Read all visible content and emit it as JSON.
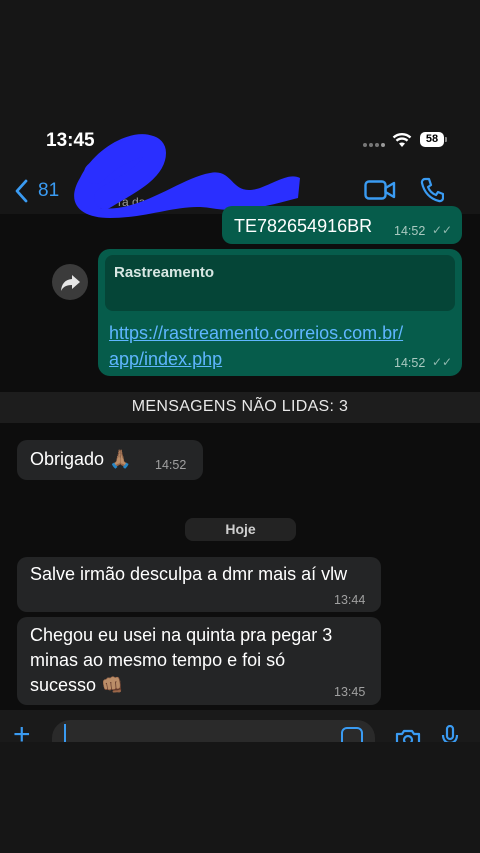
{
  "status_bar": {
    "time": "13:45",
    "battery": "58"
  },
  "header": {
    "back_count": "81",
    "contact_subtitle": "ra da ... contato"
  },
  "messages": [
    {
      "type": "outgoing",
      "text": "TE782654916BR",
      "time": "14:52"
    },
    {
      "type": "outgoing-forward",
      "quote_title": "Rastreamento",
      "link_line1": "https://rastreamento.correios.com.br/",
      "link_line2": "app/index.php",
      "time": "14:52"
    }
  ],
  "unread_banner": "MENSAGENS NÃO LIDAS: 3",
  "incoming": [
    {
      "text": "Obrigado 🙏🏽",
      "time": "14:52"
    },
    {
      "text": "Salve irmão desculpa a dmr mais aí vlw",
      "time": "13:44"
    },
    {
      "line1": "Chegou eu usei na quinta pra pegar 3",
      "line2": "minas ao mesmo tempo e foi só",
      "line3": "sucesso 👊🏽",
      "time": "13:45"
    }
  ],
  "date_divider": "Hoje",
  "icons": {
    "back": "chevron-left-icon",
    "video": "video-camera-icon",
    "phone": "phone-icon",
    "forward": "forward-arrow-icon",
    "plus": "plus-icon",
    "sticker": "sticker-icon",
    "camera": "camera-icon",
    "mic": "microphone-icon"
  },
  "colors": {
    "accent": "#3a9bf2",
    "outgoing_bubble": "#065c4b",
    "incoming_bubble": "#242526",
    "link": "#5fb6ff"
  }
}
